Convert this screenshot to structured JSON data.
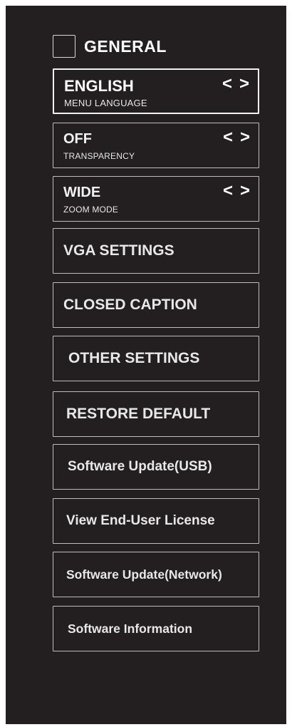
{
  "header": {
    "title": "GENERAL",
    "icon": "checkbox-square-icon"
  },
  "settings": [
    {
      "value": "ENGLISH",
      "sublabel": "MENU LANGUAGE",
      "prev": "<",
      "next": ">"
    },
    {
      "value": "OFF",
      "sublabel": "TRANSPARENCY",
      "prev": "<",
      "next": ">"
    },
    {
      "value": "WIDE",
      "sublabel": "ZOOM MODE",
      "prev": "<",
      "next": ">"
    }
  ],
  "menu": [
    "VGA SETTINGS",
    "CLOSED CAPTION",
    "OTHER SETTINGS",
    "RESTORE DEFAULT",
    "Software Update(USB)",
    "View End-User License",
    "Software Update(Network)",
    "Software Information"
  ],
  "colors": {
    "background": "#231f20",
    "text": "#ffffff",
    "border": "#bdbdbd"
  }
}
